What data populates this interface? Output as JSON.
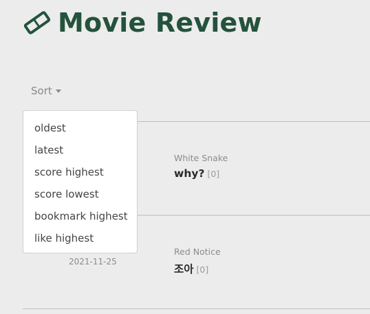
{
  "header": {
    "title": "Movie Review",
    "icon": "ticket-icon",
    "brand_color": "#24523d"
  },
  "sort": {
    "label": "Sort",
    "options": [
      "oldest",
      "latest",
      "score highest",
      "score lowest",
      "bookmark highest",
      "like highest"
    ]
  },
  "reviews": [
    {
      "movie": "White Snake",
      "comment": "why?",
      "count": "[0]"
    },
    {
      "movie": "Red Notice",
      "comment": "조아",
      "count": "[0]",
      "date": "2021-11-25"
    }
  ]
}
